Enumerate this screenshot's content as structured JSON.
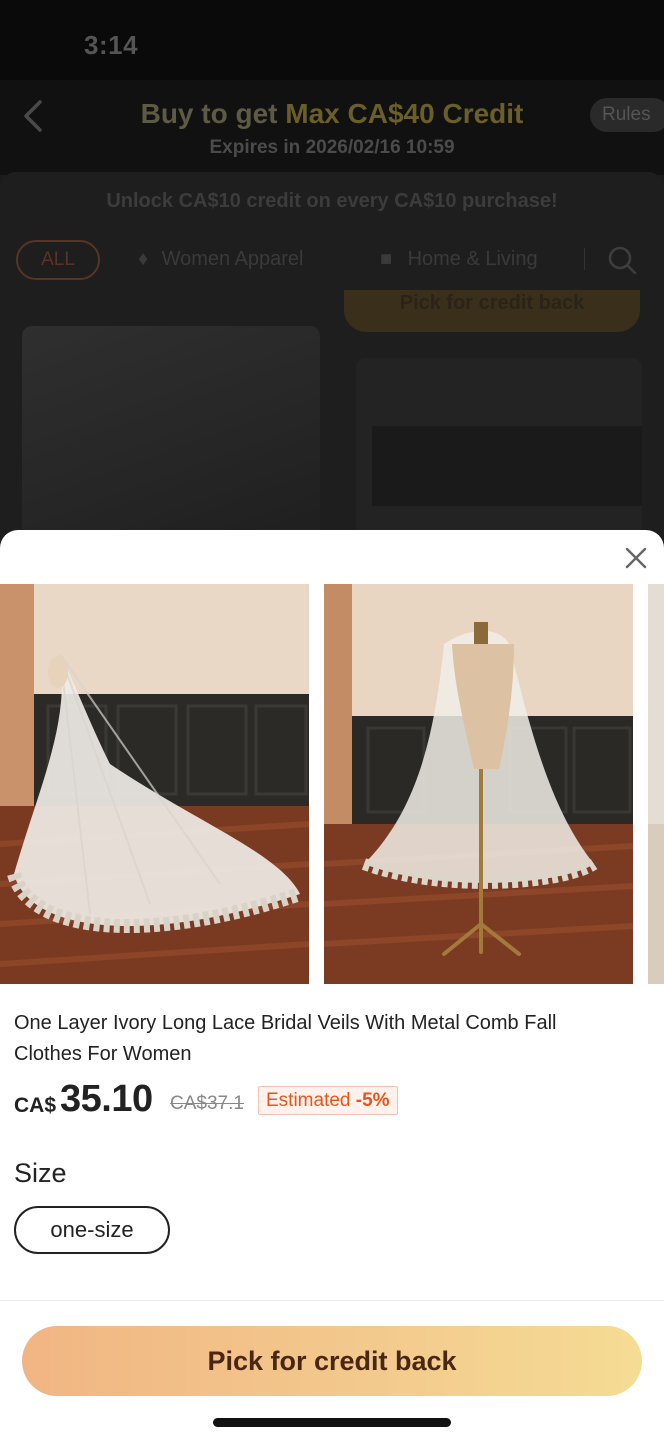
{
  "status_bar": {
    "time": "3:14"
  },
  "promo": {
    "title_prefix": "Buy to get ",
    "title_highlight": "Max CA$40 Credit",
    "expires": "Expires in 2026/02/16 10:59",
    "rules_label": "Rules",
    "unlock_text": "Unlock CA$10 credit on every CA$10 purchase!"
  },
  "categories": {
    "all_label": "ALL",
    "items": [
      {
        "label": "Women Apparel",
        "icon": "dress-icon"
      },
      {
        "label": "Home & Living",
        "icon": "sofa-icon"
      }
    ]
  },
  "background": {
    "pill_label": "Pick for credit back"
  },
  "product": {
    "title": "One Layer Ivory Long Lace Bridal Veils With Metal Comb Fall Clothes For Women",
    "currency": "CA$",
    "price": "35.10",
    "original_price": "CA$37.1",
    "estimate_label": "Estimated ",
    "estimate_pct": "-5%"
  },
  "size": {
    "label": "Size",
    "options": [
      "one-size"
    ]
  },
  "cta": {
    "label": "Pick for credit back"
  },
  "colors": {
    "cta_gradient_start": "#f1b583",
    "cta_gradient_end": "#f5dc94",
    "estimate_text": "#e8541c",
    "estimate_bg": "#fff1ec"
  }
}
